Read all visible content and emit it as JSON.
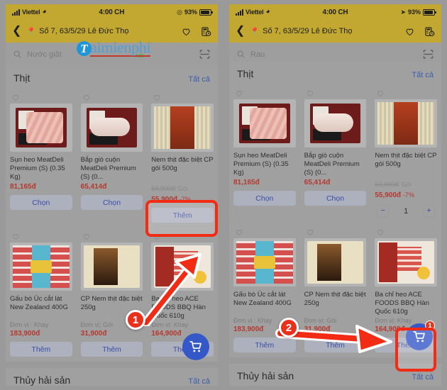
{
  "meta": {
    "watermark": {
      "letter": "T",
      "text": "aimienphi",
      "tld": ".vn"
    }
  },
  "status_bar": {
    "carrier": "Viettel",
    "time": "4:00 CH",
    "battery_text": "93%",
    "signal_icon": "signal-bars-icon",
    "wifi_icon": "wifi-icon",
    "battery_icon": "battery-icon",
    "location_icon": "location-arrow-icon"
  },
  "left_panel": {
    "app_bar": {
      "back_icon": "back-chevron-icon",
      "pin_icon": "map-pin-icon",
      "address": "Số 7, 63/5/29 Lê Đức Thọ",
      "heart_icon": "heart-icon",
      "orders_icon": "order-history-icon"
    },
    "search": {
      "placeholder": "Nước giặt",
      "search_icon": "search-icon",
      "scan_icon": "barcode-scan-icon"
    },
    "section": {
      "title": "Thịt",
      "see_all": "Tất cả"
    },
    "section2": {
      "title": "Thủy hải sản",
      "see_all": "Tất cả"
    },
    "products": [
      {
        "name": "Sụn heo MeatDeli Premium  (S) (0.35 Kg)",
        "unit": "",
        "old_price": "",
        "old_unit": "",
        "price": "81,165đ",
        "discount": "",
        "action": "Chọn",
        "art": "pork"
      },
      {
        "name": "Bắp giò cuộn MeatDeli Premium (S) (0...",
        "unit": "",
        "old_price": "",
        "old_unit": "",
        "price": "65,414đ",
        "discount": "",
        "action": "Chọn",
        "art": "roll"
      },
      {
        "name": "Nem thịt đặc biệt CP gói 500g",
        "unit": "",
        "old_price": "59,900đ",
        "old_unit": "/ Gói",
        "price": "55,900đ",
        "discount": "-7%",
        "action": "Thêm",
        "art": "nem"
      },
      {
        "name": "Gấu bò Úc cắt lát New Zealand 400G",
        "unit": "Đơn vị : Khay",
        "old_price": "",
        "old_unit": "",
        "price": "183,900đ",
        "discount": "",
        "action": "Thêm",
        "art": "beef"
      },
      {
        "name": "CP Nem thịt đặc biệt 250g",
        "unit": "Đơn vị: Gói",
        "old_price": "",
        "old_unit": "",
        "price": "31,900đ",
        "discount": "",
        "action": "Thêm",
        "art": "cp"
      },
      {
        "name": "Ba chỉ heo ACE FOODS BBQ Hàn Quốc 610g",
        "unit": "Đơn vị: Khay",
        "old_price": "",
        "old_unit": "",
        "price": "164,900đ",
        "discount": "",
        "action": "Thêm",
        "art": "bbq"
      }
    ],
    "cart": {
      "icon": "shopping-cart-icon",
      "badge": ""
    },
    "annotation": {
      "step": "1"
    }
  },
  "right_panel": {
    "app_bar": {
      "back_icon": "back-chevron-icon",
      "pin_icon": "map-pin-icon",
      "address": "Số 7, 63/5/29 Lê Đức Thọ",
      "heart_icon": "heart-icon",
      "orders_icon": "order-history-icon"
    },
    "search": {
      "placeholder": "Rau",
      "search_icon": "search-icon",
      "scan_icon": "barcode-scan-icon"
    },
    "section": {
      "title": "Thịt",
      "see_all": "Tất cả"
    },
    "section2": {
      "title": "Thủy hải sản",
      "see_all": "Tất cả"
    },
    "products": [
      {
        "name": "Sụn heo MeatDeli Premium  (S) (0.35 Kg)",
        "unit": "",
        "old_price": "",
        "old_unit": "",
        "price": "81,165đ",
        "discount": "",
        "action": "Chọn",
        "art": "pork"
      },
      {
        "name": "Bắp giò cuộn MeatDeli Premium (S) (0...",
        "unit": "",
        "old_price": "",
        "old_unit": "",
        "price": "65,414đ",
        "discount": "",
        "action": "Chọn",
        "art": "roll"
      },
      {
        "name": "Nem thịt đặc biệt CP gói 500g",
        "unit": "",
        "old_price": "59,900đ",
        "old_unit": "/ Gói",
        "price": "55,900đ",
        "discount": "-7%",
        "action": "stepper",
        "quantity": "1",
        "minus": "−",
        "plus": "+",
        "art": "nem"
      },
      {
        "name": "Gấu bò Úc cắt lát New Zealand 400G",
        "unit": "Đơn vị : Khay",
        "old_price": "",
        "old_unit": "",
        "price": "183,900đ",
        "discount": "",
        "action": "Thêm",
        "art": "beef"
      },
      {
        "name": "CP Nem thịt đặc biệt 250g",
        "unit": "Đơn vị: Gói",
        "old_price": "",
        "old_unit": "",
        "price": "31,900đ",
        "discount": "",
        "action": "Thêm",
        "art": "cp"
      },
      {
        "name": "Ba chỉ heo ACE FOODS BBQ Hàn Quốc 610g",
        "unit": "Đơn vị: Khay",
        "old_price": "",
        "old_unit": "",
        "price": "164,900đ",
        "discount": "",
        "action": "Thêm",
        "art": "bbq"
      }
    ],
    "cart": {
      "icon": "shopping-cart-icon",
      "badge": "1"
    },
    "annotation": {
      "step": "2"
    }
  },
  "colors": {
    "appbar": "#c2a831",
    "accent_blue": "#3558c8",
    "price_red": "#b5392f",
    "annotation_red": "#e8301a"
  }
}
